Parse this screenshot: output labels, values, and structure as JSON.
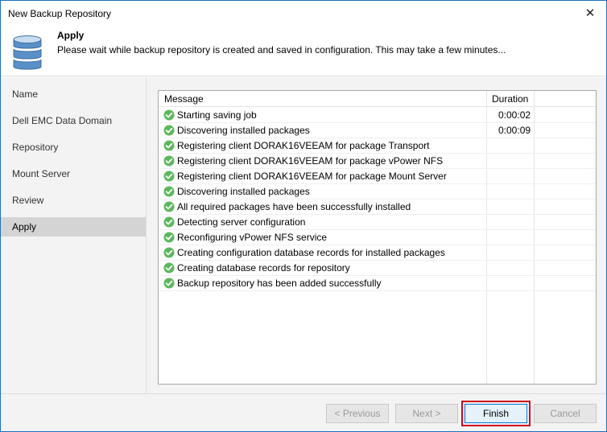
{
  "window": {
    "title": "New Backup Repository",
    "close_glyph": "✕"
  },
  "header": {
    "title": "Apply",
    "description": "Please wait while backup repository is created and saved in configuration. This may take a few minutes...",
    "icon": "database-icon"
  },
  "sidebar": {
    "items": [
      {
        "label": "Name",
        "active": false
      },
      {
        "label": "Dell EMC Data Domain",
        "active": false
      },
      {
        "label": "Repository",
        "active": false
      },
      {
        "label": "Mount Server",
        "active": false
      },
      {
        "label": "Review",
        "active": false
      },
      {
        "label": "Apply",
        "active": true
      }
    ]
  },
  "log": {
    "columns": {
      "message": "Message",
      "duration": "Duration"
    },
    "rows": [
      {
        "message": "Starting saving job",
        "duration": "0:00:02"
      },
      {
        "message": "Discovering installed packages",
        "duration": "0:00:09"
      },
      {
        "message": "Registering client DORAK16VEEAM for package Transport",
        "duration": ""
      },
      {
        "message": "Registering client DORAK16VEEAM for package vPower NFS",
        "duration": ""
      },
      {
        "message": "Registering client DORAK16VEEAM for package Mount Server",
        "duration": ""
      },
      {
        "message": "Discovering installed packages",
        "duration": ""
      },
      {
        "message": "All required packages have been successfully installed",
        "duration": ""
      },
      {
        "message": "Detecting server configuration",
        "duration": ""
      },
      {
        "message": "Reconfiguring vPower NFS service",
        "duration": ""
      },
      {
        "message": "Creating configuration database records for installed packages",
        "duration": ""
      },
      {
        "message": "Creating database records for repository",
        "duration": ""
      },
      {
        "message": "Backup repository has been added successfully",
        "duration": ""
      }
    ],
    "status_icon": "success-check-icon",
    "status_color": "#5cb85c"
  },
  "footer": {
    "previous_label": "< Previous",
    "next_label": "Next >",
    "finish_label": "Finish",
    "cancel_label": "Cancel"
  },
  "colors": {
    "highlight": "#d0021b",
    "accent": "#0078d7"
  }
}
